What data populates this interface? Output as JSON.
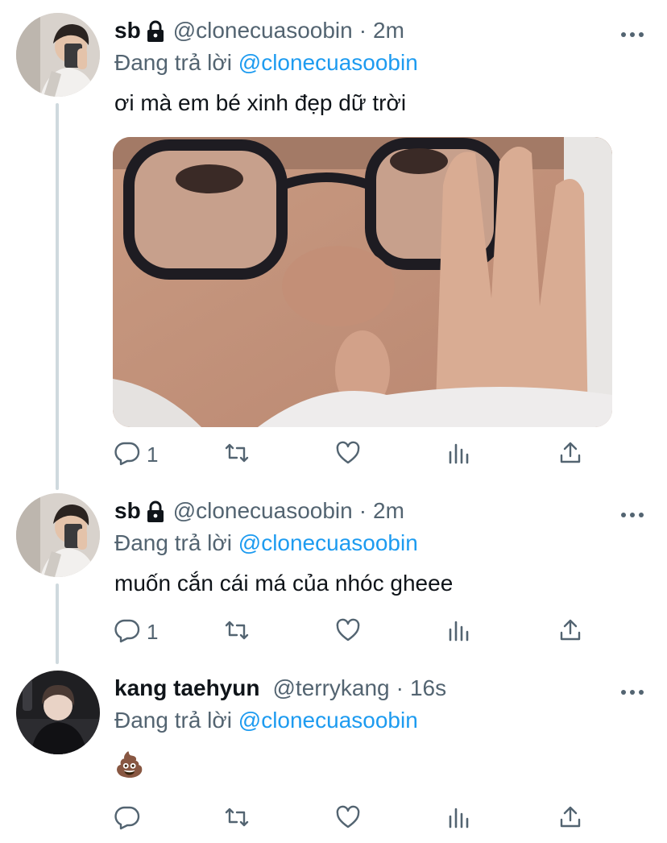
{
  "tweets": [
    {
      "name": "sb",
      "protected": true,
      "handle": "@clonecuasoobin",
      "time": "2m",
      "replying_prefix": "Đang trả lời",
      "replying_to": "@clonecuasoobin",
      "text": "ơi mà em bé xinh đẹp dữ trời",
      "has_media": true,
      "reply_count": "1"
    },
    {
      "name": "sb",
      "protected": true,
      "handle": "@clonecuasoobin",
      "time": "2m",
      "replying_prefix": "Đang trả lời",
      "replying_to": "@clonecuasoobin",
      "text": "muốn cắn cái má của nhóc gheee",
      "has_media": false,
      "reply_count": "1"
    },
    {
      "name": "kang taehyun",
      "protected": false,
      "handle": "@terrykang",
      "time": "16s",
      "replying_prefix": "Đang trả lời",
      "replying_to": "@clonecuasoobin",
      "text": "💩",
      "has_media": false,
      "reply_count": ""
    }
  ],
  "separator": "·",
  "colors": {
    "accent": "#1d9bf0",
    "secondary": "#536471",
    "thread_line": "#cfd9de"
  },
  "icons": [
    "lock-icon",
    "more-icon",
    "reply-icon",
    "retweet-icon",
    "like-icon",
    "analytics-icon",
    "share-icon"
  ]
}
